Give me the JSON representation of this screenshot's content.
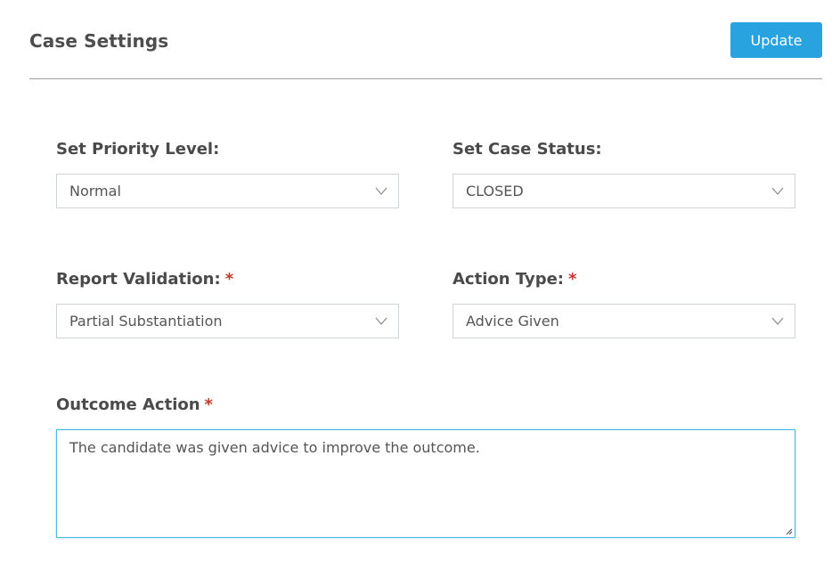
{
  "header": {
    "title": "Case Settings",
    "update_label": "Update"
  },
  "fields": {
    "priority": {
      "label": "Set Priority Level:",
      "value": "Normal",
      "required": false
    },
    "status": {
      "label": "Set Case Status:",
      "value": "CLOSED",
      "required": false
    },
    "validation": {
      "label": "Report Validation:",
      "value": "Partial Substantiation",
      "required": true
    },
    "action_type": {
      "label": "Action Type:",
      "value": "Advice Given",
      "required": true
    },
    "outcome": {
      "label": "Outcome Action",
      "value": "The candidate was given advice to improve the outcome.",
      "required": true
    }
  },
  "required_marker": "*",
  "colors": {
    "accent": "#29a3e0",
    "required": "#c0392b",
    "focus_border": "#4fb6e8"
  },
  "icons": {
    "dropdown": "chevron-down-icon",
    "resize": "resize-handle-icon"
  }
}
